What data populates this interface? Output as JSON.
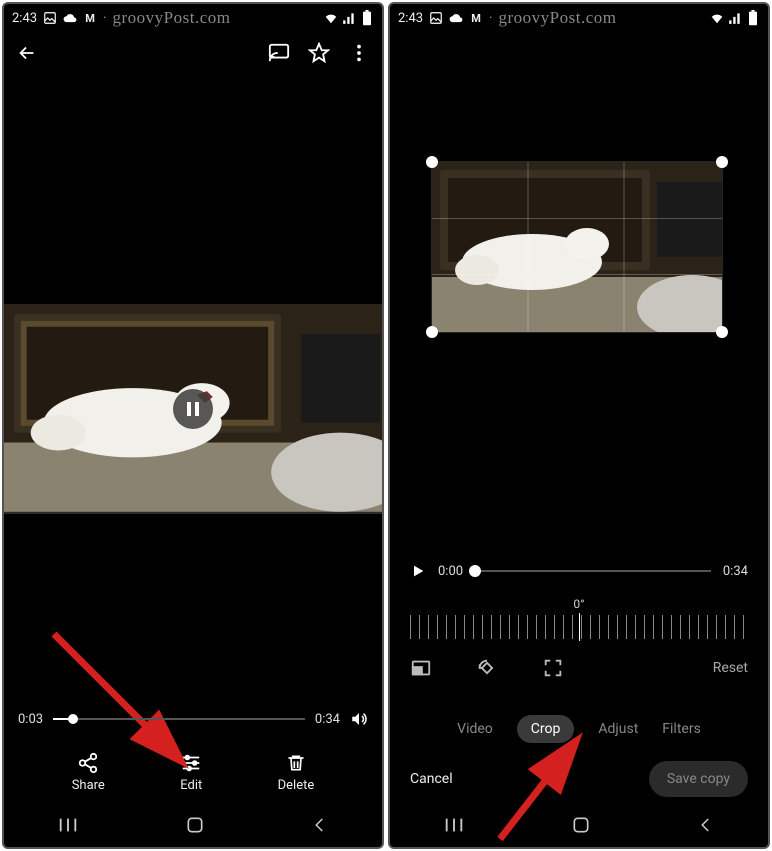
{
  "status": {
    "time": "2:43"
  },
  "watermark": "groovyPost.com",
  "left": {
    "time_current": "0:03",
    "time_total": "0:34",
    "actions": {
      "share": "Share",
      "edit": "Edit",
      "delete": "Delete"
    }
  },
  "right": {
    "time_current": "0:00",
    "time_total": "0:34",
    "rotation": "0°",
    "reset": "Reset",
    "tabs": {
      "video": "Video",
      "crop": "Crop",
      "adjust": "Adjust",
      "filters": "Filters"
    },
    "cancel": "Cancel",
    "save": "Save copy"
  }
}
